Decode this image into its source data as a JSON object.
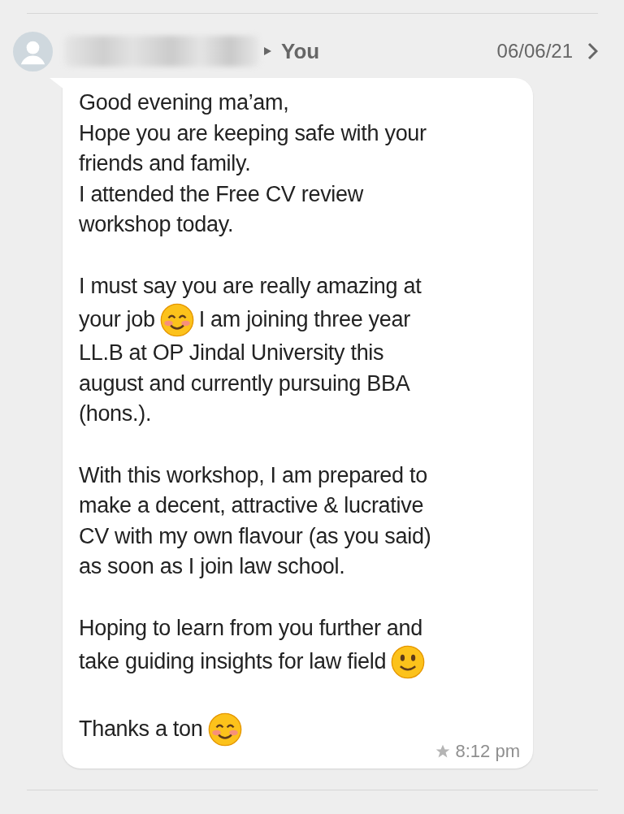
{
  "header": {
    "recipient": "You",
    "date": "06/06/21"
  },
  "message": {
    "paragraphs": [
      [
        [
          {
            "kind": "text",
            "text": "Good evening ma’am,"
          }
        ],
        [
          {
            "kind": "text",
            "text": "Hope you are keeping safe with your"
          }
        ],
        [
          {
            "kind": "text",
            "text": "friends and family."
          }
        ],
        [
          {
            "kind": "text",
            "text": "I attended the Free CV review"
          }
        ],
        [
          {
            "kind": "text",
            "text": "workshop today."
          }
        ]
      ],
      [
        [
          {
            "kind": "text",
            "text": "I must say you are really amazing at"
          }
        ],
        [
          {
            "kind": "text",
            "text": "your job"
          },
          {
            "kind": "emoji-blush"
          },
          {
            "kind": "text",
            "text": "I am joining three year"
          }
        ],
        [
          {
            "kind": "text",
            "text": "LL.B at OP Jindal University this"
          }
        ],
        [
          {
            "kind": "text",
            "text": "august and currently pursuing BBA"
          }
        ],
        [
          {
            "kind": "text",
            "text": "(hons.)."
          }
        ]
      ],
      [
        [
          {
            "kind": "text",
            "text": "With this workshop, I am prepared to"
          }
        ],
        [
          {
            "kind": "text",
            "text": "make a decent, attractive & lucrative"
          }
        ],
        [
          {
            "kind": "text",
            "text": "CV with my own flavour (as you said)"
          }
        ],
        [
          {
            "kind": "text",
            "text": "as soon as I join law school."
          }
        ]
      ],
      [
        [
          {
            "kind": "text",
            "text": "Hoping to learn from you further and"
          }
        ],
        [
          {
            "kind": "text",
            "text": "take guiding insights for law field"
          },
          {
            "kind": "emoji-smile"
          }
        ]
      ],
      [
        [
          {
            "kind": "text",
            "text": "Thanks a ton"
          },
          {
            "kind": "emoji-blush"
          }
        ]
      ]
    ],
    "time": "8:12 pm"
  }
}
